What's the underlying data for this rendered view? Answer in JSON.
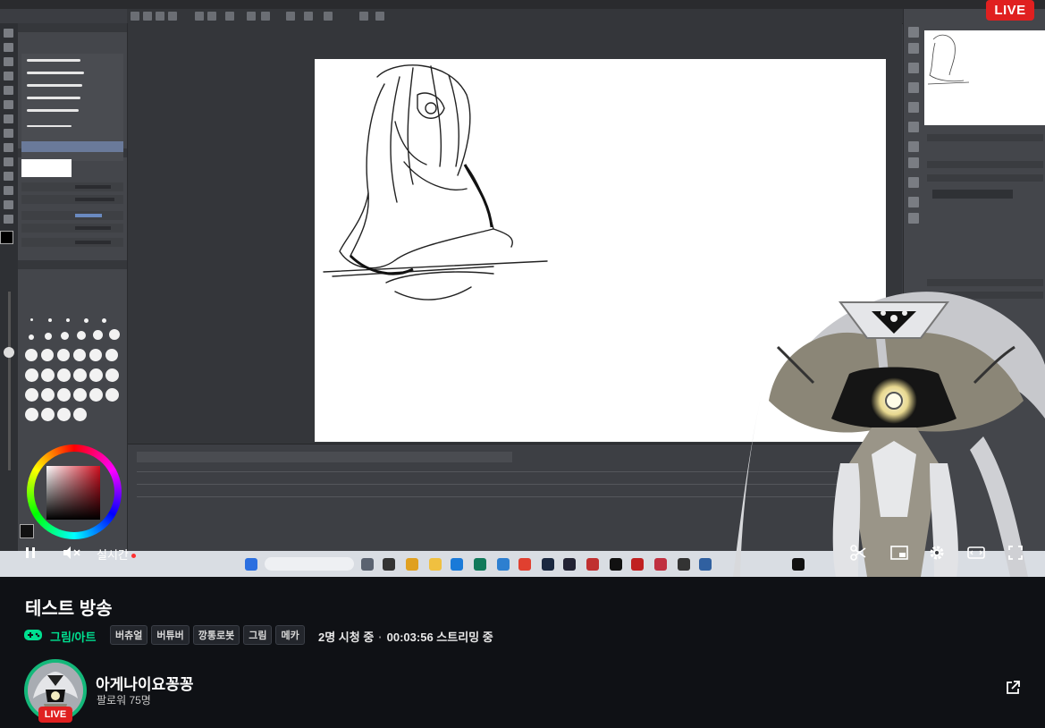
{
  "player": {
    "live_badge": "LIVE",
    "realtime_label": "실시간",
    "controls": {
      "pause": "pause-icon",
      "mute": "mute-icon",
      "clip": "scissors-icon",
      "pip": "picture-in-picture-icon",
      "settings": "gear-icon",
      "theater": "theater-mode-icon",
      "fullscreen": "fullscreen-icon"
    }
  },
  "stream": {
    "title": "테스트 방송",
    "category": "그림/아트",
    "tags": [
      "버츄얼",
      "버튜버",
      "깡통로봇",
      "그림",
      "메카"
    ],
    "viewers": "2명 시청 중",
    "uptime": "00:03:56 스트리밍 중"
  },
  "channel": {
    "name": "아게나이요꽁꽁",
    "followers": "팔로워 75명",
    "live_badge": "LIVE"
  },
  "colors": {
    "live_red": "#e02020",
    "category_green": "#00e090",
    "avatar_ring": "#14b87a",
    "page_bg": "#0f1115"
  }
}
